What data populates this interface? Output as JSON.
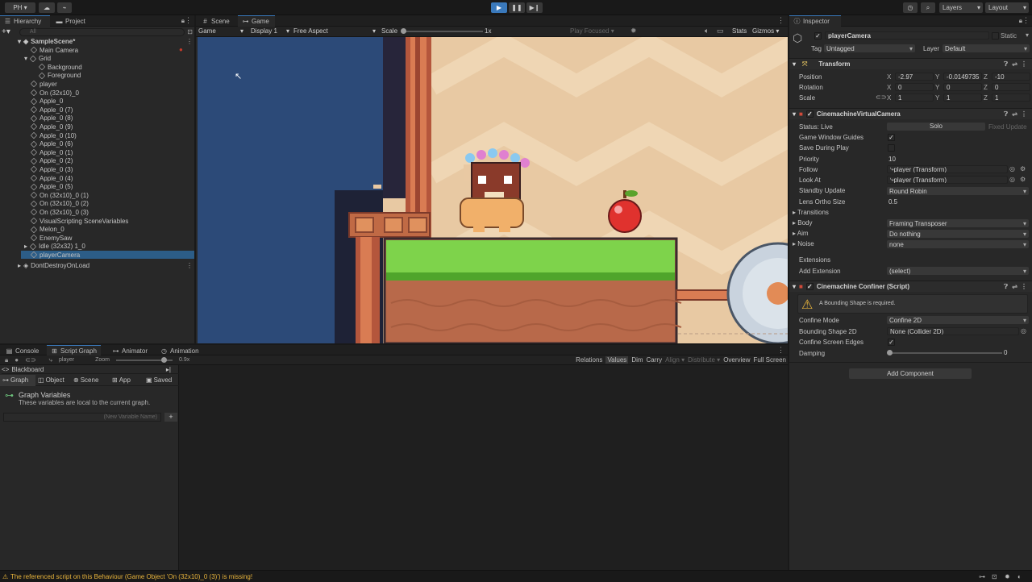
{
  "toolbar": {
    "account": "PH",
    "layers": "Layers",
    "layout": "Layout"
  },
  "hierarchy": {
    "tab": "Hierarchy",
    "project_tab": "Project",
    "search_placeholder": "All",
    "scene": "SampleScene*",
    "items": [
      "Main Camera",
      "Grid",
      "Background",
      "Foreground",
      "player",
      "On (32x10)_0",
      "Apple_0",
      "Apple_0 (7)",
      "Apple_0 (8)",
      "Apple_0 (9)",
      "Apple_0 (10)",
      "Apple_0 (6)",
      "Apple_0 (1)",
      "Apple_0 (2)",
      "Apple_0 (3)",
      "Apple_0 (4)",
      "Apple_0 (5)",
      "On (32x10)_0 (1)",
      "On (32x10)_0 (2)",
      "On (32x10)_0 (3)",
      "VisualScripting SceneVariables",
      "Melon_0",
      "EnemySaw",
      "Idle (32x32) 1_0",
      "playerCamera"
    ],
    "dont_destroy": "DontDestroyOnLoad"
  },
  "game": {
    "scene_tab": "Scene",
    "game_tab": "Game",
    "mode": "Game",
    "display": "Display 1",
    "aspect": "Free Aspect",
    "scale_label": "Scale",
    "scale_value": "1x",
    "play_focused": "Play Focused",
    "stats": "Stats",
    "gizmos": "Gizmos"
  },
  "bottom": {
    "tabs": [
      "Console",
      "Script Graph",
      "Animator",
      "Animation"
    ],
    "graph_object": "player",
    "zoom_label": "Zoom",
    "zoom_value": "0.9x",
    "blackboard": "Blackboard",
    "bb_tabs": [
      "Graph",
      "Object",
      "Scene",
      "App",
      "Saved"
    ],
    "graph_vars_title": "Graph Variables",
    "graph_vars_desc": "These variables are local to the current graph.",
    "new_var_placeholder": "(New Variable Name)",
    "right_tools": [
      "Relations",
      "Values",
      "Dim",
      "Carry",
      "Align",
      "Distribute",
      "Overview",
      "Full Screen"
    ]
  },
  "inspector": {
    "tab": "Inspector",
    "name": "playerCamera",
    "static": "Static",
    "tag_label": "Tag",
    "tag": "Untagged",
    "layer_label": "Layer",
    "layer": "Default",
    "transform": {
      "title": "Transform",
      "position_label": "Position",
      "rotation_label": "Rotation",
      "scale_label": "Scale",
      "position": [
        "-2.97",
        "-0.0149735",
        "-10"
      ],
      "rotation": [
        "0",
        "0",
        "0"
      ],
      "scale": [
        "1",
        "1",
        "1"
      ]
    },
    "vcam": {
      "title": "CinemachineVirtualCamera",
      "status": "Status: Live",
      "solo": "Solo",
      "fixed_update": "Fixed Update",
      "labels": [
        "Game Window Guides",
        "Save During Play",
        "Priority",
        "Follow",
        "Look At",
        "Standby Update",
        "Lens Ortho Size",
        "Transitions",
        "Body",
        "Aim",
        "Noise"
      ],
      "priority": "10",
      "follow": "player (Transform)",
      "look_at": "player (Transform)",
      "standby": "Round Robin",
      "ortho": "0.5",
      "body": "Framing Transposer",
      "aim": "Do nothing",
      "noise": "none",
      "extensions": "Extensions",
      "add_extension_label": "Add Extension",
      "add_extension": "(select)"
    },
    "confiner": {
      "title": "Cinemachine Confiner (Script)",
      "warning": "A Bounding Shape is required.",
      "labels": [
        "Confine Mode",
        "Bounding Shape 2D",
        "Confine Screen Edges",
        "Damping"
      ],
      "mode": "Confine 2D",
      "shape": "None (Collider 2D)",
      "damping": "0"
    },
    "add_component": "Add Component"
  },
  "status": {
    "message": "The referenced script on this Behaviour (Game Object 'On (32x10)_0 (3)') is missing!"
  },
  "colors": {
    "accent": "#3a79bb",
    "panel": "#282828",
    "sky": "#2c4a78",
    "grass": "#7ed34b",
    "warning": "#e9b53c"
  }
}
